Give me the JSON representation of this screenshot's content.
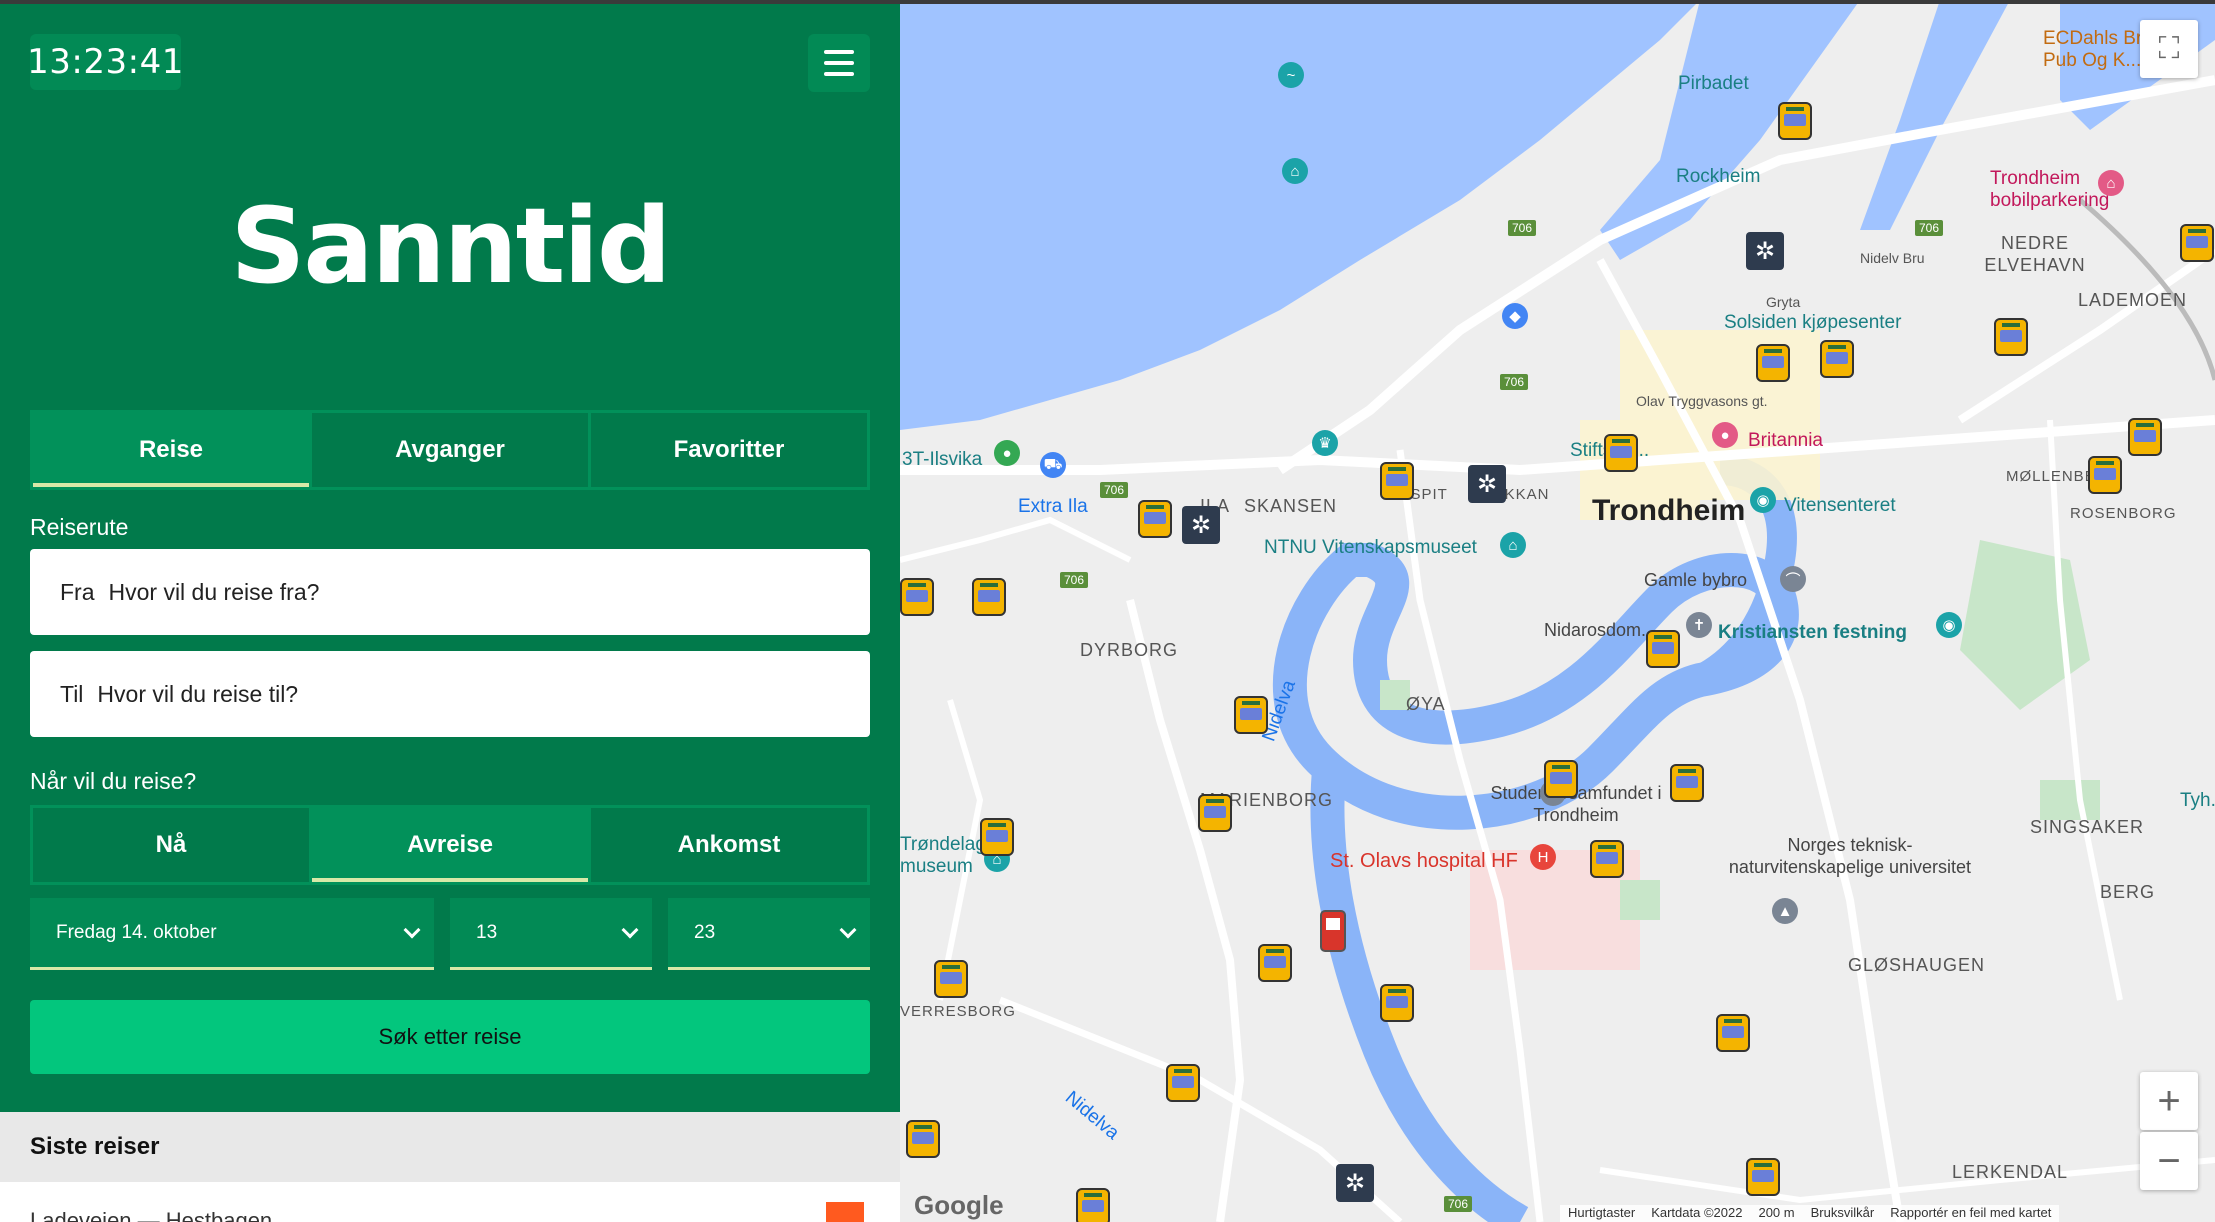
{
  "header": {
    "clock": "13:23:41",
    "title": "Sanntid"
  },
  "tabs": [
    {
      "label": "Reise",
      "active": true
    },
    {
      "label": "Avganger",
      "active": false
    },
    {
      "label": "Favoritter",
      "active": false
    }
  ],
  "route": {
    "section_label": "Reiserute",
    "from_label": "Fra",
    "from_placeholder": "Hvor vil du reise fra?",
    "to_label": "Til",
    "to_placeholder": "Hvor vil du reise til?"
  },
  "when": {
    "section_label": "Når vil du reise?",
    "options": [
      {
        "label": "Nå",
        "active": false
      },
      {
        "label": "Avreise",
        "active": true
      },
      {
        "label": "Ankomst",
        "active": false
      }
    ],
    "date": "Fredag 14. oktober",
    "hour": "13",
    "minute": "23"
  },
  "search_button": "Søk etter reise",
  "recent": {
    "title": "Siste reiser",
    "first_trip": "Ladeveien — Hestbagen"
  },
  "map": {
    "labels": {
      "pirbadet": "Pirbadet",
      "rockheim": "Rockheim",
      "ecdahls": "ECDahls Br... Pub Og K...",
      "bobil": "Trondheim bobilparkering",
      "nedre_elvehavn": "NEDRE ELVEHAVN",
      "lademoen": "LADEMOEN",
      "nidelv_bru": "Nidelv Bru",
      "gryta": "Gryta",
      "solsiden": "Solsiden kjøpesenter",
      "olav": "Olav Tryggvasons gt.",
      "stiftsgarden": "Stiftsgå...",
      "britannia": "Britannia",
      "trondheim": "Trondheim",
      "vitensenteret": "Vitensenteret",
      "ilsvika": "3T-Ilsvika",
      "extra_ila": "Extra Ila",
      "skansen": "SKANSEN",
      "ila": "ILA",
      "hospit": "HOSPIT",
      "okkan": "ØKKAN",
      "ntnu_vit": "NTNU Vitenskapsmuseet",
      "gamle_bybro": "Gamle bybro",
      "nidarosdom": "Nidarosdom...",
      "kristiansten": "Kristiansten festning",
      "dyrborg": "DYRBORG",
      "oya": "ØYA",
      "studentersamfundet": "Studentersamfundet i Trondheim",
      "marienborg": "MARIENBORG",
      "trondelag": "Trøndelag museum",
      "st_olavs": "St. Olavs hospital HF",
      "ntnu": "Norges teknisk-naturvitenskapelige universitet",
      "singsaker": "SINGSAKER",
      "berg": "BERG",
      "gloshaugen": "GLØSHAUGEN",
      "mollenberg": "MØLLENBERG",
      "rosenborg": "ROSENBORG",
      "lerkendal": "LERKENDAL",
      "tyholt": "Tyh...",
      "verresborg": "VERRESBORG",
      "nidelva": "Nidelva",
      "nidelva2": "Nidelva"
    },
    "road_number": "706",
    "attribution": {
      "shortcuts": "Hurtigtaster",
      "mapdata": "Kartdata ©2022",
      "scale": "200 m",
      "terms": "Bruksvilkår",
      "report": "Rapportér en feil med kartet"
    },
    "google_logo": "Google",
    "zoom_in": "+",
    "zoom_out": "−"
  },
  "colors": {
    "panel": "#017a4b",
    "panel_light": "#028a55",
    "accent": "#03c67d",
    "water": "#a0c3ff",
    "river": "#8ab4f8"
  }
}
